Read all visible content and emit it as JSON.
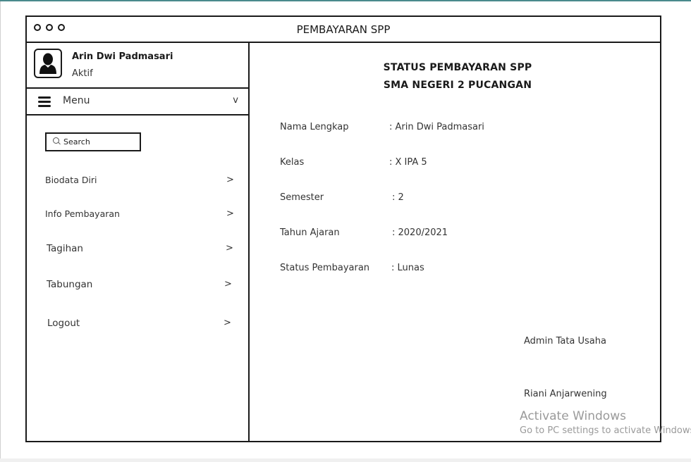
{
  "window": {
    "title": "PEMBAYARAN SPP"
  },
  "user": {
    "name": "Arin Dwi Padmasari",
    "status": "Aktif"
  },
  "menu": {
    "label": "Menu",
    "chevron": "v"
  },
  "search": {
    "text": "Search"
  },
  "nav": [
    {
      "label": "Biodata Diri",
      "arrow": ">"
    },
    {
      "label": "Info Pembayaran",
      "arrow": ">"
    },
    {
      "label": "Tagihan",
      "arrow": ">"
    },
    {
      "label": "Tabungan",
      "arrow": ">"
    },
    {
      "label": "Logout",
      "arrow": ">"
    }
  ],
  "main": {
    "title_line1": "STATUS  PEMBAYARAN  SPP",
    "title_line2": "SMA NEGERI 2 PUCANGAN",
    "fields": [
      {
        "label": "Nama Lengkap",
        "value": ":  Arin Dwi Padmasari"
      },
      {
        "label": "Kelas",
        "value": ":  X IPA 5"
      },
      {
        "label": "Semester",
        "value": ": 2"
      },
      {
        "label": "Tahun Ajaran",
        "value": ": 2020/2021"
      },
      {
        "label": "Status Pembayaran",
        "value": ":  Lunas"
      }
    ],
    "signatory_role": "Admin Tata Usaha",
    "signatory_name": "Riani Anjarwening"
  },
  "watermark": {
    "line1": "Activate Windows",
    "line2": "Go to PC settings to activate Windows."
  }
}
